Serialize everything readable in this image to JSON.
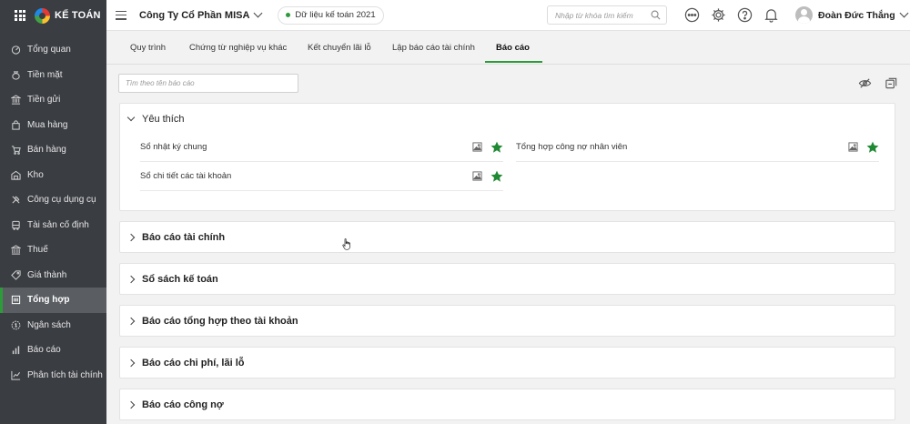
{
  "app": {
    "logo_text": "KẾ TOÁN"
  },
  "sidebar": {
    "items": [
      {
        "label": "Tổng quan",
        "icon": "dashboard-icon"
      },
      {
        "label": "Tiền mặt",
        "icon": "cash-bag-icon"
      },
      {
        "label": "Tiền gửi",
        "icon": "bank-icon"
      },
      {
        "label": "Mua hàng",
        "icon": "shopping-bag-icon"
      },
      {
        "label": "Bán hàng",
        "icon": "cart-icon"
      },
      {
        "label": "Kho",
        "icon": "warehouse-icon"
      },
      {
        "label": "Công cụ dụng cụ",
        "icon": "tools-icon"
      },
      {
        "label": "Tài sản cố định",
        "icon": "car-icon"
      },
      {
        "label": "Thuế",
        "icon": "tax-building-icon"
      },
      {
        "label": "Giá thành",
        "icon": "price-tag-icon"
      },
      {
        "label": "Tổng hợp",
        "icon": "summary-icon",
        "active": true
      },
      {
        "label": "Ngân sách",
        "icon": "budget-icon"
      },
      {
        "label": "Báo cáo",
        "icon": "report-bars-icon"
      },
      {
        "label": "Phân tích tài chính",
        "icon": "analysis-chart-icon"
      }
    ]
  },
  "header": {
    "company": "Công Ty Cổ Phần MISA",
    "dataset": "Dữ liệu kế toán 2021",
    "search_placeholder": "Nhập từ khóa tìm kiếm",
    "user_name": "Đoàn Đức Thắng"
  },
  "tabs": [
    {
      "label": "Quy trình"
    },
    {
      "label": "Chứng từ nghiệp vụ khác"
    },
    {
      "label": "Kết chuyển lãi lỗ"
    },
    {
      "label": "Lập báo cáo tài chính"
    },
    {
      "label": "Báo cáo",
      "active": true
    }
  ],
  "report_search": {
    "placeholder": "Tìm theo tên báo cáo"
  },
  "favorites": {
    "title": "Yêu thích",
    "items": [
      {
        "label": "Sổ nhật ký chung"
      },
      {
        "label": "Tổng hợp công nợ nhân viên"
      },
      {
        "label": "Sổ chi tiết các tài khoản"
      }
    ]
  },
  "groups": [
    {
      "label": "Báo cáo tài chính"
    },
    {
      "label": "Sổ sách kế toán"
    },
    {
      "label": "Báo cáo tổng hợp theo tài khoản"
    },
    {
      "label": "Báo cáo chi phí, lãi lỗ"
    },
    {
      "label": "Báo cáo công nợ"
    }
  ],
  "colors": {
    "accent": "#2e9b3a",
    "sidebar_bg": "#3a3d42",
    "star": "#1f8a33"
  }
}
